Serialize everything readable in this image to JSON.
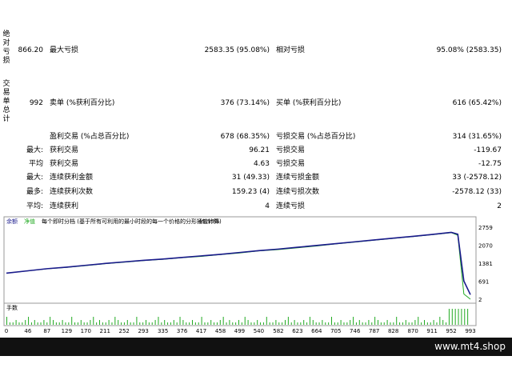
{
  "report": {
    "section_absolute": "绝对亏损",
    "section_trades": "交易单总计",
    "rows": [
      {
        "c1": "866.20",
        "c2": "最大亏损",
        "c3": "2583.35 (95.08%)",
        "c4": "相对亏损",
        "c5": "95.08% (2583.35)"
      },
      {
        "c1": "992",
        "c2": "卖单 (%获利百分比)",
        "c3": "376 (73.14%)",
        "c4": "买单 (%获利百分比)",
        "c5": "616 (65.42%)"
      },
      {
        "c1": "",
        "c2": "盈利交易 (%占总百分比)",
        "c3": "678 (68.35%)",
        "c4": "亏损交易 (%占总百分比)",
        "c5": "314 (31.65%)"
      },
      {
        "c1": "最大:",
        "c2": "获利交易",
        "c3": "96.21",
        "c4": "亏损交易",
        "c5": "-119.67"
      },
      {
        "c1": "平均",
        "c2": "获利交易",
        "c3": "4.63",
        "c4": "亏损交易",
        "c5": "-12.75"
      },
      {
        "c1": "最大:",
        "c2": "连续获利金额",
        "c3": "31 (49.33)",
        "c4": "连续亏损金额",
        "c5": "33 (-2578.12)"
      },
      {
        "c1": "最多:",
        "c2": "连续获利次数",
        "c3": "159.23 (4)",
        "c4": "连续亏损次数",
        "c5": "-2578.12 (33)"
      },
      {
        "c1": "平均:",
        "c2": "连续获利",
        "c3": "4",
        "c4": "连续亏损",
        "c5": "2"
      }
    ]
  },
  "chart": {
    "header_a": "余额",
    "header_b": "净值",
    "header_c": "每个即时分档 (基于所有可利用的最小时段的每一个价格的分形插值计算)",
    "header_d": "49.99%",
    "volume_label": "手数",
    "y_labels": [
      "2759",
      "2070",
      "1381",
      "691",
      "2"
    ],
    "x_labels": [
      "0",
      "46",
      "87",
      "129",
      "170",
      "211",
      "252",
      "293",
      "335",
      "376",
      "417",
      "458",
      "499",
      "540",
      "582",
      "623",
      "664",
      "705",
      "746",
      "787",
      "828",
      "870",
      "911",
      "952",
      "993"
    ],
    "colors": {
      "balance": "#1a1a8c",
      "equity": "#22aa22",
      "volume": "#22aa22"
    }
  },
  "watermark": "www.mt4.shop",
  "chart_data": {
    "type": "line",
    "x": [
      0,
      46,
      87,
      129,
      170,
      211,
      252,
      293,
      335,
      376,
      417,
      458,
      499,
      540,
      582,
      623,
      664,
      705,
      746,
      787,
      828,
      870,
      911,
      952,
      966,
      979,
      993
    ],
    "series": [
      {
        "name": "余额",
        "values": [
          1000,
          1090,
          1170,
          1230,
          1300,
          1370,
          1430,
          1490,
          1540,
          1600,
          1660,
          1720,
          1790,
          1860,
          1920,
          1990,
          2060,
          2130,
          2200,
          2270,
          2340,
          2410,
          2480,
          2560,
          2490,
          700,
          176
        ]
      },
      {
        "name": "净值",
        "values": [
          1000,
          1085,
          1165,
          1220,
          1290,
          1360,
          1420,
          1480,
          1530,
          1590,
          1640,
          1710,
          1770,
          1850,
          1900,
          1970,
          2040,
          2120,
          2190,
          2260,
          2330,
          2400,
          2470,
          2550,
          2450,
          200,
          2
        ]
      }
    ],
    "ylim": [
      2,
      2759
    ],
    "xlim": [
      0,
      993
    ]
  }
}
